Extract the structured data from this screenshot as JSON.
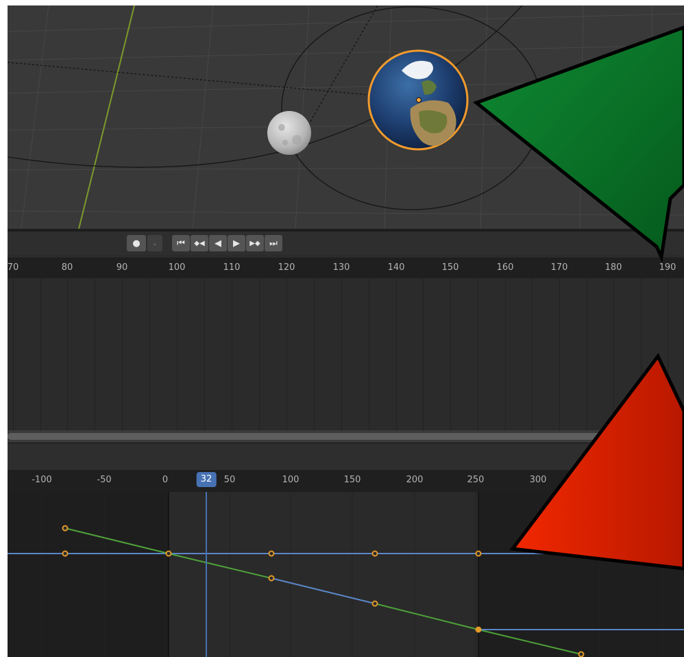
{
  "viewport": {
    "objects": [
      "earth",
      "moon"
    ]
  },
  "timeline": {
    "controls": {
      "record": "●",
      "record_dropdown": "⌄",
      "jump_start": "⏮",
      "prev_keyframe": "◆◀",
      "play_reverse": "◀",
      "play": "▶",
      "next_keyframe": "▶◆",
      "jump_end": "⏭"
    },
    "ruler": [
      "70",
      "80",
      "90",
      "100",
      "110",
      "120",
      "130",
      "140",
      "150",
      "160",
      "170",
      "180",
      "190"
    ]
  },
  "graph_editor": {
    "current_frame": "32",
    "ruler": [
      "-100",
      "-50",
      "0",
      "50",
      "100",
      "150",
      "200",
      "250",
      "300"
    ],
    "colors": {
      "x_curve": "#5b86c8",
      "y_curve": "#4fa33a",
      "keyframe": "#e39a2a",
      "playhead": "#4772b3"
    }
  },
  "annotations": {
    "arrow_top_color": "#0b7a2c",
    "arrow_bottom_color": "#e52a00"
  }
}
